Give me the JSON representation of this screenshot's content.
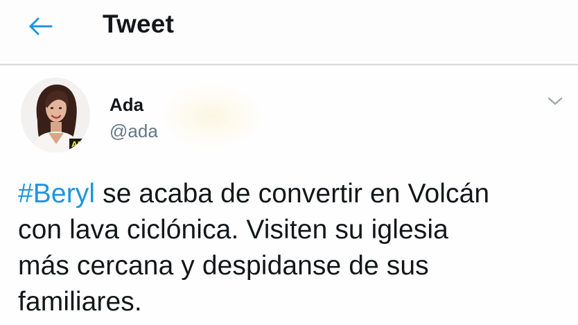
{
  "header": {
    "title": "Tweet",
    "back_icon": "arrow-left-icon"
  },
  "tweet": {
    "author": {
      "name": "Ada",
      "handle": "@ada",
      "avatar_badge": "AN"
    },
    "caret_icon": "chevron-down-icon",
    "text": {
      "hashtag": "#Beryl",
      "line1_rest": " se acaba de convertir en Volcán",
      "line2": "con lava ciclónica. Visiten su iglesia",
      "line3": "más cercana y despidanse de sus",
      "line4": "familiares."
    }
  },
  "colors": {
    "accent": "#1b95e0",
    "text_primary": "#14171a",
    "text_secondary": "#657786",
    "divider": "#d9dcdf"
  }
}
